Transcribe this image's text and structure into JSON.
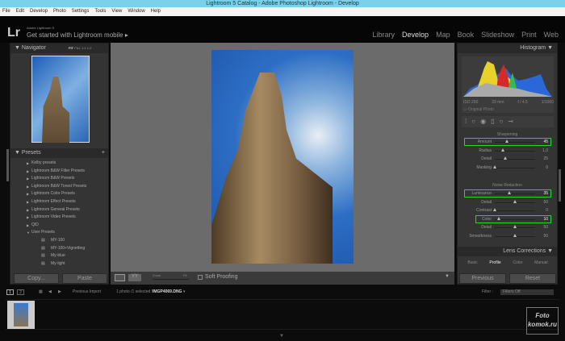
{
  "window": {
    "title": "Lightroom 5 Catalog - Adobe Photoshop Lightroom - Develop"
  },
  "menu": [
    "File",
    "Edit",
    "Develop",
    "Photo",
    "Settings",
    "Tools",
    "View",
    "Window",
    "Help"
  ],
  "brand": {
    "logo": "Lr",
    "product": "Adobe Lightroom 5",
    "tagline": "Get started with Lightroom mobile ▸"
  },
  "modules": [
    "Library",
    "Develop",
    "Map",
    "Book",
    "Slideshow",
    "Print",
    "Web"
  ],
  "navigator": {
    "title": "Navigator",
    "options": [
      "FIT",
      "FILL",
      "1:1",
      "1:2"
    ]
  },
  "presets": {
    "title": "Presets",
    "add": "+",
    "folders": [
      "Kelby presets",
      "Lightroom B&W Filter Presets",
      "Lightroom B&W Presets",
      "Lightroom B&W Toned Presets",
      "Lightroom Color Presets",
      "Lightroom Effect Presets",
      "Lightroom General Presets",
      "Lightroom Video Presets",
      "QID",
      "User Presets"
    ],
    "user_presets": [
      "MY-100",
      "MY-100+Vignetting",
      "My-blue",
      "My-light"
    ]
  },
  "left_buttons": {
    "copy": "Copy...",
    "paste": "Paste"
  },
  "toolbar": {
    "zoom_label": "Zoom",
    "zoom_value": "Fit",
    "soft_proofing": "Soft Proofing"
  },
  "histogram": {
    "title": "Histogram",
    "iso": "ISO 200",
    "focal": "33 mm",
    "aperture": "f / 4,5",
    "shutter": "1/1000",
    "original_photo": "Original Photo"
  },
  "sharpening": {
    "title": "Sharpening",
    "sliders": [
      {
        "label": "Amount",
        "value": "45",
        "pos": 0.3
      },
      {
        "label": "Radius",
        "value": "1,0",
        "pos": 0.2
      },
      {
        "label": "Detail",
        "value": "25",
        "pos": 0.25
      },
      {
        "label": "Masking",
        "value": "0",
        "pos": 0.0
      }
    ]
  },
  "noise": {
    "title": "Noise Reduction",
    "sliders": [
      {
        "label": "Luminance",
        "value": "35",
        "pos": 0.35
      },
      {
        "label": "Detail",
        "value": "50",
        "pos": 0.5
      },
      {
        "label": "Contrast",
        "value": "0",
        "pos": 0.0
      },
      {
        "label": "Color",
        "value": "10",
        "pos": 0.1
      },
      {
        "label": "Detail",
        "value": "50",
        "pos": 0.5
      },
      {
        "label": "Smoothness",
        "value": "50",
        "pos": 0.5
      }
    ]
  },
  "lens": {
    "title": "Lens Corrections",
    "tabs": [
      "Basic",
      "Profile",
      "Color",
      "Manual"
    ]
  },
  "right_buttons": {
    "previous": "Previous",
    "reset": "Reset"
  },
  "filmstrip": {
    "pages": [
      "1",
      "2"
    ],
    "source": "Previous Import",
    "info": "1 photo /1 selected /",
    "filename": "IMGP4069.DNG",
    "filter_label": "Filter :",
    "filter_value": "Filters Off"
  },
  "watermark": "Foto komok.ru"
}
